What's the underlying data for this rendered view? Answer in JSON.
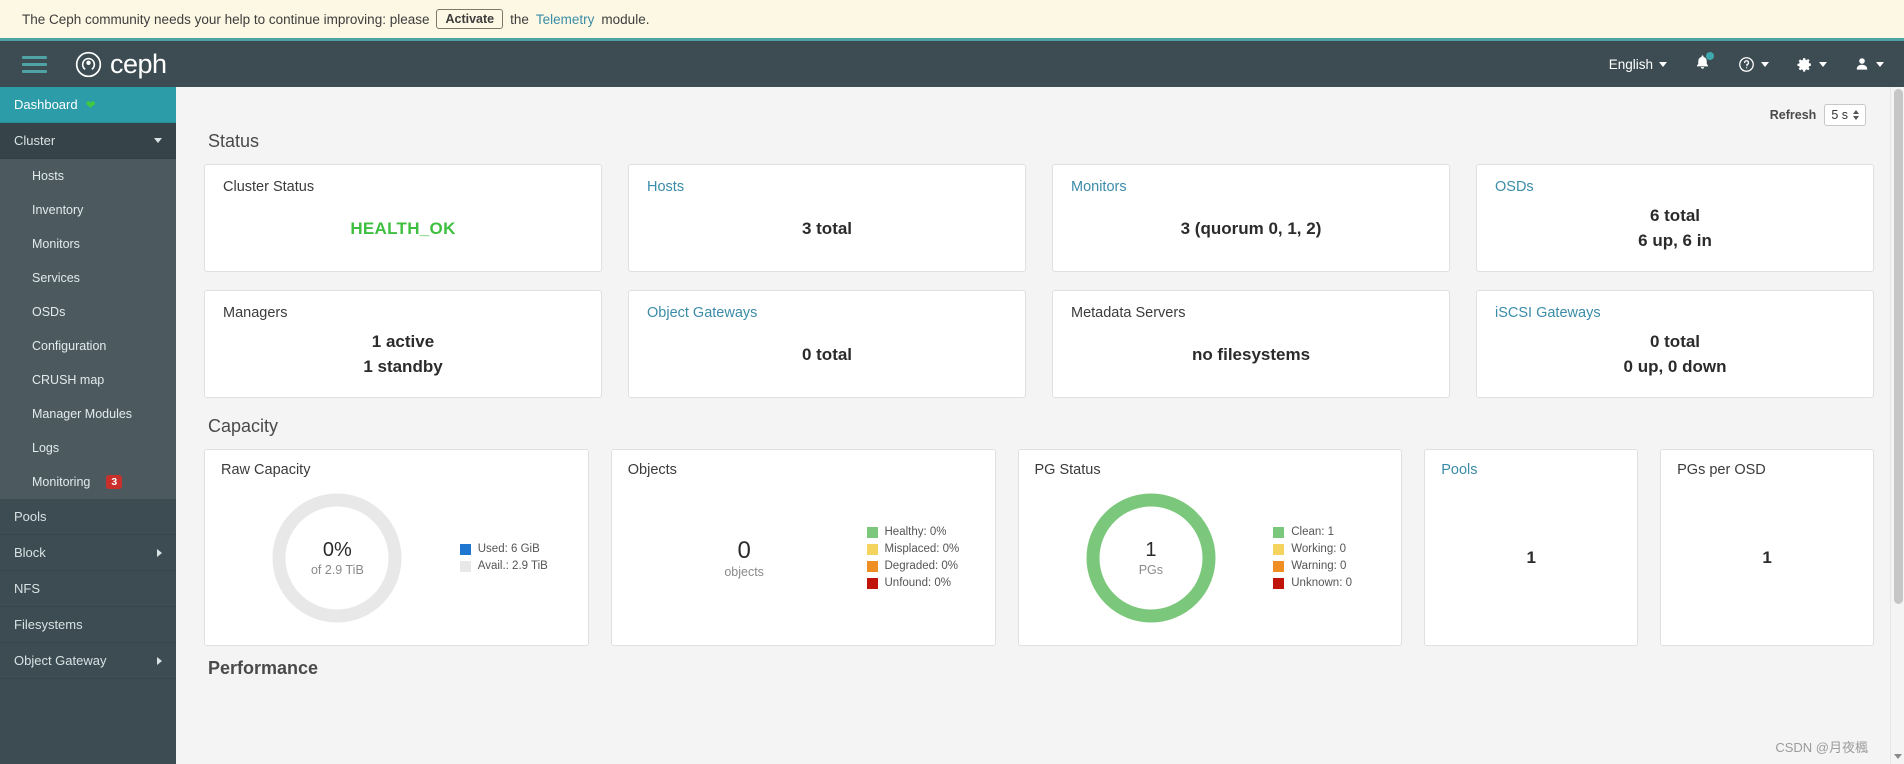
{
  "telemetry": {
    "text_before": "The Ceph community needs your help to continue improving: please",
    "activate_label": "Activate",
    "text_mid": "the",
    "link_label": "Telemetry",
    "text_after": "module."
  },
  "navbar": {
    "brand": "ceph",
    "menu_icon": "hamburger-icon",
    "language": "English",
    "notifications_icon": "bell-icon",
    "help_icon": "help-circle-icon",
    "settings_icon": "gear-icon",
    "user_icon": "user-icon"
  },
  "sidebar": {
    "items": [
      {
        "label": "Dashboard",
        "state": "active",
        "icon": "heart-pulse-icon"
      },
      {
        "label": "Cluster",
        "state": "group-open",
        "chevron": "down"
      },
      {
        "label": "Hosts",
        "state": "sub"
      },
      {
        "label": "Inventory",
        "state": "sub"
      },
      {
        "label": "Monitors",
        "state": "sub"
      },
      {
        "label": "Services",
        "state": "sub"
      },
      {
        "label": "OSDs",
        "state": "sub"
      },
      {
        "label": "Configuration",
        "state": "sub"
      },
      {
        "label": "CRUSH map",
        "state": "sub"
      },
      {
        "label": "Manager Modules",
        "state": "sub"
      },
      {
        "label": "Logs",
        "state": "sub"
      },
      {
        "label": "Monitoring",
        "state": "sub",
        "badge": "3"
      },
      {
        "label": "Pools",
        "state": "top"
      },
      {
        "label": "Block",
        "state": "top",
        "chevron": "right"
      },
      {
        "label": "NFS",
        "state": "top"
      },
      {
        "label": "Filesystems",
        "state": "top"
      },
      {
        "label": "Object Gateway",
        "state": "top",
        "chevron": "right"
      }
    ]
  },
  "toolbar": {
    "refresh_label": "Refresh",
    "refresh_interval": "5 s"
  },
  "status": {
    "heading": "Status",
    "cards": [
      {
        "title": "Cluster Status",
        "is_link": false,
        "value": "HEALTH_OK",
        "value_style": "health-ok"
      },
      {
        "title": "Hosts",
        "is_link": true,
        "value": "3 total"
      },
      {
        "title": "Monitors",
        "is_link": true,
        "value": "3 (quorum 0, 1, 2)"
      },
      {
        "title": "OSDs",
        "is_link": true,
        "value_line1": "6 total",
        "value_line2": "6 up, 6 in"
      },
      {
        "title": "Managers",
        "is_link": false,
        "value_line1": "1 active",
        "value_line2": "1 standby"
      },
      {
        "title": "Object Gateways",
        "is_link": true,
        "value": "0 total"
      },
      {
        "title": "Metadata Servers",
        "is_link": false,
        "value": "no filesystems"
      },
      {
        "title": "iSCSI Gateways",
        "is_link": true,
        "value_line1": "0 total",
        "value_line2": "0 up, 0 down"
      }
    ]
  },
  "capacity": {
    "heading": "Capacity",
    "raw_capacity": {
      "title": "Raw Capacity",
      "center_value": "0%",
      "center_sub": "of 2.9 TiB",
      "legend": [
        {
          "label": "Used: 6 GiB",
          "color": "#1f77d0"
        },
        {
          "label": "Avail.: 2.9 TiB",
          "color": "#e8e8e8"
        }
      ]
    },
    "objects": {
      "title": "Objects",
      "center_value": "0",
      "center_sub": "objects",
      "legend": [
        {
          "label": "Healthy: 0%",
          "color": "#7bc77b"
        },
        {
          "label": "Misplaced: 0%",
          "color": "#f4d35e"
        },
        {
          "label": "Degraded: 0%",
          "color": "#ef8e22"
        },
        {
          "label": "Unfound: 0%",
          "color": "#c0140a"
        }
      ]
    },
    "pg_status": {
      "title": "PG Status",
      "center_value": "1",
      "center_sub": "PGs",
      "legend": [
        {
          "label": "Clean: 1",
          "color": "#7bc77b"
        },
        {
          "label": "Working: 0",
          "color": "#f4d35e"
        },
        {
          "label": "Warning: 0",
          "color": "#ef8e22"
        },
        {
          "label": "Unknown: 0",
          "color": "#c0140a"
        }
      ]
    },
    "pools": {
      "title": "Pools",
      "is_link": true,
      "value": "1"
    },
    "pgs_per_osd": {
      "title": "PGs per OSD",
      "is_link": false,
      "value": "1"
    }
  },
  "performance": {
    "heading": "Performance"
  },
  "watermark": "CSDN @月夜楓",
  "chart_data": [
    {
      "type": "pie",
      "title": "Raw Capacity",
      "labels": [
        "Used: 6 GiB",
        "Avail.: 2.9 TiB"
      ],
      "values": [
        0,
        100
      ],
      "colors": [
        "#1f77d0",
        "#e8e8e8"
      ],
      "center_text": "0%",
      "center_subtext": "of 2.9 TiB",
      "legend_position": "right"
    },
    {
      "type": "pie",
      "title": "Objects",
      "labels": [
        "Healthy: 0%",
        "Misplaced: 0%",
        "Degraded: 0%",
        "Unfound: 0%"
      ],
      "values": [
        0,
        0,
        0,
        0
      ],
      "colors": [
        "#7bc77b",
        "#f4d35e",
        "#ef8e22",
        "#c0140a"
      ],
      "center_text": "0",
      "center_subtext": "objects",
      "legend_position": "right"
    },
    {
      "type": "pie",
      "title": "PG Status",
      "labels": [
        "Clean: 1",
        "Working: 0",
        "Warning: 0",
        "Unknown: 0"
      ],
      "values": [
        1,
        0,
        0,
        0
      ],
      "colors": [
        "#7bc77b",
        "#f4d35e",
        "#ef8e22",
        "#c0140a"
      ],
      "center_text": "1",
      "center_subtext": "PGs",
      "legend_position": "right"
    }
  ]
}
